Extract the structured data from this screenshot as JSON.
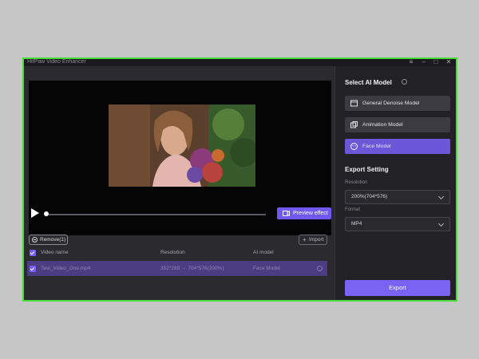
{
  "app": {
    "title": "HitPaw Video Enhancer"
  },
  "window_controls": {
    "menu_icon": "menu-icon",
    "minimize_icon": "minimize-icon",
    "maximize_icon": "maximize-icon",
    "close_icon": "close-icon"
  },
  "player": {
    "preview_button": "Preview effect",
    "play_icon": "play-icon",
    "progress": 0.0
  },
  "list": {
    "remove_button": "Remove(1)",
    "import_button": "Import",
    "columns": {
      "video_name": "Video name",
      "resolution": "Resolution",
      "ai_model": "AI model"
    },
    "row": {
      "name": "Test_Video_One.mp4",
      "resolution": "352*288 → 704*576(200%)",
      "model": "Face Model",
      "checked": true
    },
    "header_checked": true
  },
  "sidebar": {
    "select_title": "Select AI Model",
    "models": [
      {
        "label": "General Denoise Model",
        "icon": "film-icon",
        "selected": false
      },
      {
        "label": "Animation Model",
        "icon": "animation-icon",
        "selected": false
      },
      {
        "label": "Face Model",
        "icon": "face-icon",
        "selected": true
      }
    ],
    "export_title": "Export Setting",
    "resolution_label": "Resolution",
    "resolution_value": "200%(704*576)",
    "format_label": "Format",
    "format_value": "MP4",
    "export_button": "Export"
  },
  "colors": {
    "accent": "#7a62f2",
    "window_border": "#4ddb3c",
    "selected_row": "#4a3d82"
  }
}
